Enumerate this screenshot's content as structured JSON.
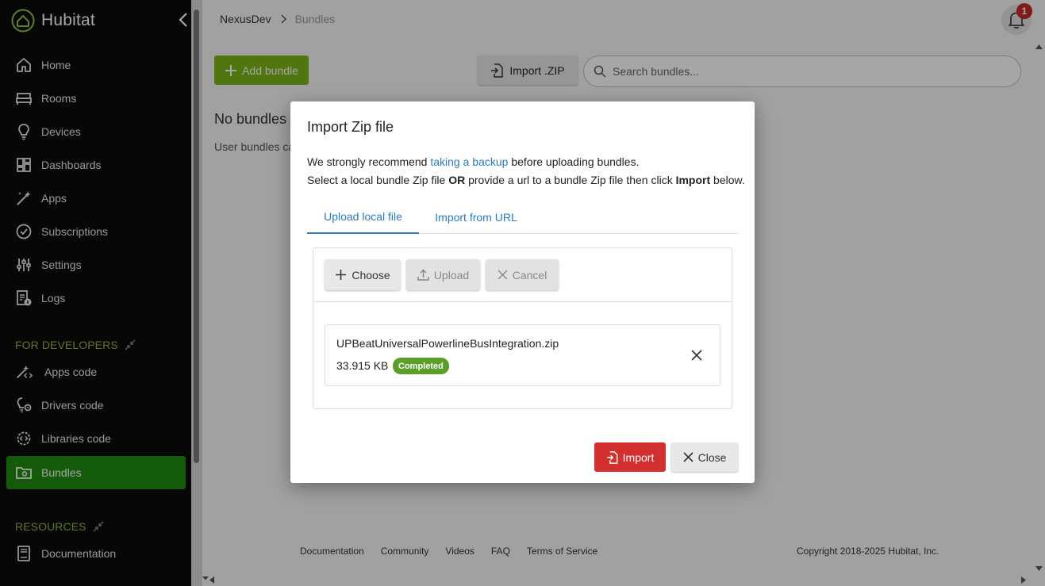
{
  "brand": {
    "name": "Hubitat",
    "accent": "#8fc43a"
  },
  "sidebar": {
    "items": [
      {
        "label": "Home",
        "icon": "home-icon"
      },
      {
        "label": "Rooms",
        "icon": "bed-icon"
      },
      {
        "label": "Devices",
        "icon": "lightbulb-icon"
      },
      {
        "label": "Dashboards",
        "icon": "dashboard-icon"
      },
      {
        "label": "Apps",
        "icon": "magic-wand-icon"
      },
      {
        "label": "Subscriptions",
        "icon": "check-circle-icon"
      },
      {
        "label": "Settings",
        "icon": "sliders-icon"
      },
      {
        "label": "Logs",
        "icon": "log-file-icon"
      }
    ],
    "dev_section": "FOR DEVELOPERS",
    "dev_items": [
      {
        "label": "Apps code",
        "icon": "magic-wand-code-icon"
      },
      {
        "label": "Drivers code",
        "icon": "lightbulb-gear-icon"
      },
      {
        "label": "Libraries code",
        "icon": "gear-code-icon"
      },
      {
        "label": "Bundles",
        "icon": "folder-gear-icon",
        "active": true
      }
    ],
    "res_section": "RESOURCES",
    "res_items": [
      {
        "label": "Documentation",
        "icon": "book-icon"
      }
    ],
    "active_color": "#1f8a12"
  },
  "header": {
    "breadcrumb_home": "NexusDev",
    "breadcrumb_current": "Bundles",
    "notification_count": "1"
  },
  "toolbar": {
    "add_label": "Add bundle",
    "import_label": "Import .ZIP",
    "search_placeholder": "Search bundles..."
  },
  "empty": {
    "title": "No bundles",
    "subtitle": "User bundles ca"
  },
  "footer": {
    "links": [
      "Documentation",
      "Community",
      "Videos",
      "FAQ",
      "Terms of Service"
    ],
    "copyright": "Copyright 2018-2025 Hubitat, Inc."
  },
  "dialog": {
    "title": "Import Zip file",
    "line1_pre": "We strongly recommend ",
    "line1_link": "taking a backup",
    "line1_post": " before uploading bundles.",
    "line2_a": "Select a local bundle Zip file ",
    "line2_or": "OR",
    "line2_b": " provide a url to a bundle Zip file then click ",
    "line2_import": "Import",
    "line2_c": " below.",
    "tabs": [
      {
        "label": "Upload local file",
        "active": true
      },
      {
        "label": "Import from URL",
        "active": false
      }
    ],
    "choose_label": "Choose",
    "upload_label": "Upload",
    "cancel_label": "Cancel",
    "file": {
      "name": "UPBeatUniversalPowerlineBusIntegration.zip",
      "size": "33.915 KB",
      "status": "Completed"
    },
    "import_label": "Import",
    "close_label": "Close",
    "import_color": "#d32f2f"
  }
}
